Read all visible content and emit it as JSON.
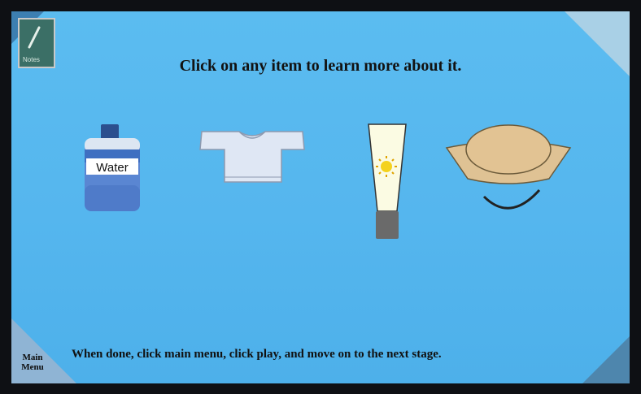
{
  "instructions": "Click on any item to learn more about it.",
  "footer_text": "When done, click main menu, click play, and move on to the next stage.",
  "main_menu": {
    "line1": "Main",
    "line2": "Menu"
  },
  "notes_button": {
    "label": "Notes"
  },
  "items": [
    {
      "name": "water-bottle",
      "label": "Water"
    },
    {
      "name": "long-sleeve-shirt"
    },
    {
      "name": "sunscreen"
    },
    {
      "name": "sun-hat"
    }
  ],
  "colors": {
    "background": "#55b6ee",
    "frame": "#0e1014",
    "text": "#121212"
  }
}
